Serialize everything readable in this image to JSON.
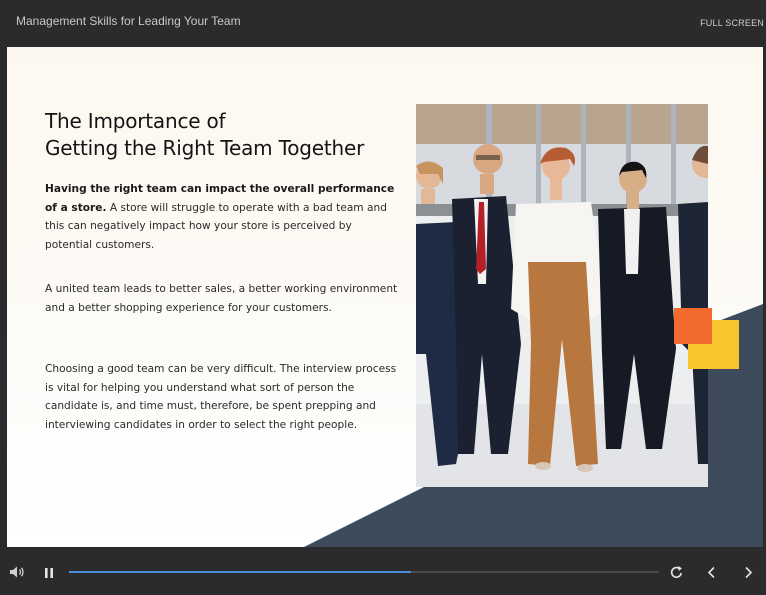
{
  "header": {
    "course_title": "Management Skills for Leading Your Team",
    "fullscreen_label": "FULL SCREEN"
  },
  "slide": {
    "heading_line1": "The Importance of",
    "heading_line2": "Getting the Right Team Together",
    "p1_bold": "Having the right team can impact the overall performance of a store.",
    "p1_rest": " A store will struggle to operate with a bad team and this can negatively impact how your store is perceived by potential customers.",
    "p2": "A united team leads to better sales, a better working environment and a better shopping experience for your customers.",
    "p3": "Choosing a good team can be very difficult. The interview process is vital for helping you understand what sort of person the candidate is, and time must, therefore, be spent prepping and interviewing candidates in order to select the right people.",
    "colors": {
      "navy": "#3c4a5c",
      "orange": "#f26a2e",
      "yellow": "#f9c42c"
    }
  },
  "player": {
    "progress_percent": 58,
    "icons": [
      "volume-icon",
      "pause-icon",
      "replay-icon",
      "chevron-left-icon",
      "chevron-right-icon"
    ]
  }
}
